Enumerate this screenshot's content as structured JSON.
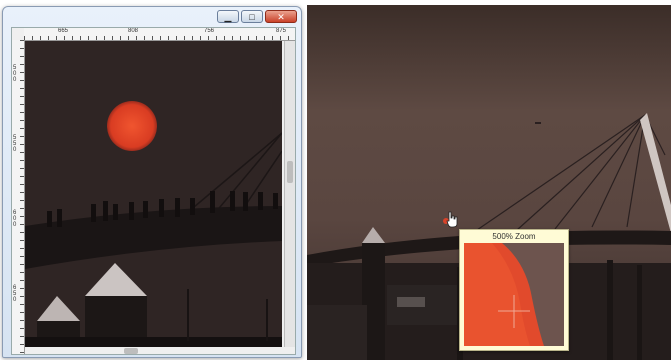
{
  "window": {
    "controls": {
      "minimize_icon": "minimize-icon",
      "maximize_icon": "maximize-icon",
      "close_icon": "close-icon"
    }
  },
  "ruler": {
    "top_ticks": [
      "665",
      "808",
      "756",
      "875"
    ],
    "left_ticks": [
      "500",
      "550",
      "600",
      "650"
    ]
  },
  "magnifier": {
    "title": "500% Zoom"
  },
  "colors": {
    "sky_dark": "#2f2524",
    "sun": "#e2452a",
    "sky_dusk": "#5a4640"
  }
}
